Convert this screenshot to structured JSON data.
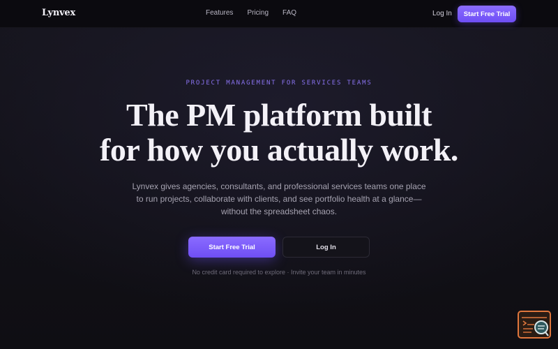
{
  "brand": {
    "name": "Lynvex"
  },
  "nav": {
    "links": [
      "Features",
      "Pricing",
      "FAQ"
    ],
    "login": "Log In",
    "cta": "Start Free Trial"
  },
  "hero": {
    "eyebrow": "PROJECT MANAGEMENT FOR SERVICES TEAMS",
    "headline_line1": "The PM platform built",
    "headline_line2": "for how you actually work.",
    "subheading": "Lynvex gives agencies, consultants, and professional services teams one place to run projects, collaborate with clients, and see portfolio health at a glance—without the spreadsheet chaos.",
    "primary_cta": "Start Free Trial",
    "secondary_cta": "Log In",
    "note": "No credit card required to explore · Invite your team in minutes"
  },
  "widget": {
    "icon": "terminal-search-icon"
  },
  "colors": {
    "accent": "#7c5cfc",
    "background": "#121118",
    "nav_background": "#0b0a0f",
    "widget_border": "#e0763c"
  }
}
